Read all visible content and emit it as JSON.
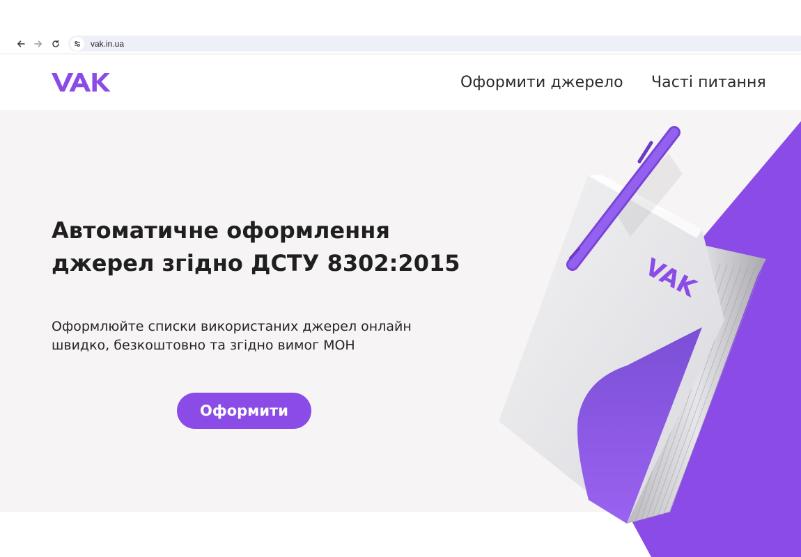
{
  "browser": {
    "url": "vak.in.ua"
  },
  "header": {
    "logo_text": "VAK",
    "nav": [
      {
        "label": "Оформити джерело"
      },
      {
        "label": "Часті питання"
      }
    ]
  },
  "hero": {
    "title": "Автоматичне оформлення джерел згідно ДСТУ 8302:2015",
    "subtitle": "Оформлюйте списки використаних джерел онлайн швидко, безкоштовно та згідно вимог МОН",
    "cta_label": "Оформити",
    "illustration_logo_text": "VAK"
  },
  "colors": {
    "brand": "#8a4be6",
    "hero_background": "#f6f4f5"
  }
}
